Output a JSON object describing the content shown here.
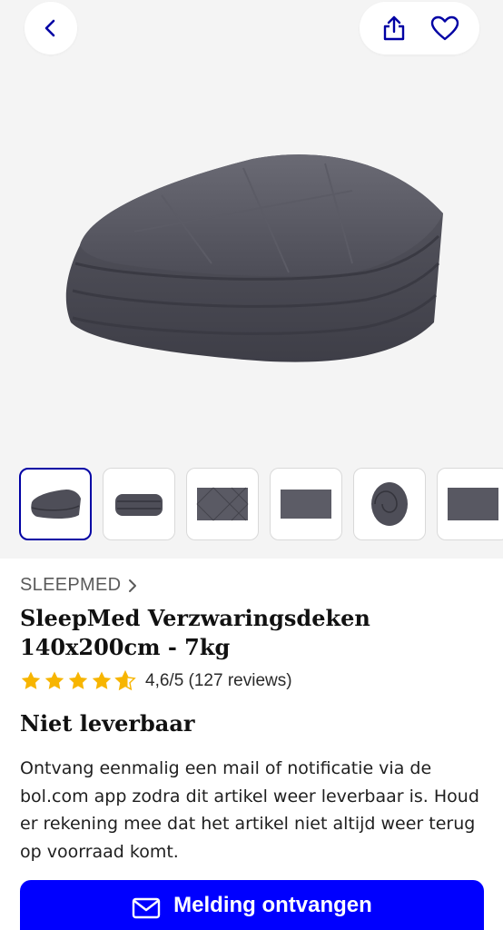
{
  "header": {
    "back_icon": "chevron-left-icon",
    "share_icon": "share-icon",
    "wishlist_icon": "heart-icon",
    "accent_color": "#0000a4"
  },
  "gallery": {
    "main_image": "weighted-blanket-folded",
    "thumbnails": [
      {
        "name": "folded-blanket",
        "active": true
      },
      {
        "name": "folded-blanket-side",
        "active": false
      },
      {
        "name": "blanket-flat-quilted",
        "active": false
      },
      {
        "name": "blanket-flat-texture",
        "active": false
      },
      {
        "name": "blanket-rolled",
        "active": false
      },
      {
        "name": "blanket-fabric-closeup",
        "active": false
      }
    ]
  },
  "product": {
    "brand": "SLEEPMED",
    "title": "SleepMed Verzwaringsdeken 140x200cm - 7kg",
    "rating_value": 4.6,
    "rating_text": "4,6/5 (127 reviews)",
    "star_color": "#f7b500",
    "availability": "Niet leverbaar",
    "description": "Ontvang eenmalig een mail of notificatie via de bol.com app zodra dit artikel weer leverbaar is. Houd er rekening mee dat het artikel niet altijd weer terug op voorraad komt."
  },
  "cta": {
    "label": "Melding ontvangen",
    "icon": "mail-icon",
    "color": "#0000ff"
  }
}
